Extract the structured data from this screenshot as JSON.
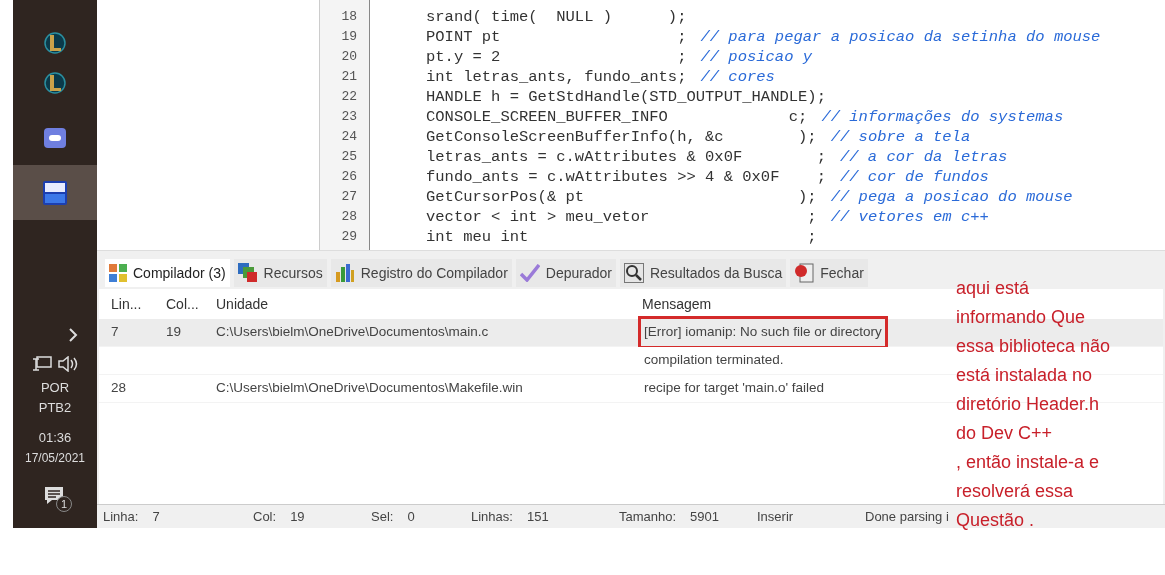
{
  "taskbar": {
    "apps": [
      {
        "kind": "game",
        "active": false
      },
      {
        "kind": "game",
        "active": false
      },
      {
        "kind": "chat",
        "active": false
      },
      {
        "kind": "ide",
        "active": true
      }
    ],
    "language": "POR",
    "layout": "PTB2",
    "time": "01:36",
    "date": "17/05/2021",
    "notifications": "1"
  },
  "editor": {
    "lines": [
      {
        "n": "18",
        "code": "srand( time(  NULL )      );"
      },
      {
        "n": "19",
        "code": "POINT pt                   ;",
        "comment": "// para pegar a posicao da setinha do mouse"
      },
      {
        "n": "20",
        "code": "pt.y = 2                   ;",
        "comment": "// posicao y"
      },
      {
        "n": "21",
        "code": "int letras_ants, fundo_ants;",
        "comment": "// cores"
      },
      {
        "n": "22",
        "code": "HANDLE h = GetStdHandle(STD_OUTPUT_HANDLE);"
      },
      {
        "n": "23",
        "code": "CONSOLE_SCREEN_BUFFER_INFO             c;",
        "comment": "// informações do systemas"
      },
      {
        "n": "24",
        "code": "GetConsoleScreenBufferInfo(h, &c        );",
        "comment": "// sobre a tela"
      },
      {
        "n": "25",
        "code": "letras_ants = c.wAttributes & 0x0F        ;",
        "comment": "// a cor da letras"
      },
      {
        "n": "26",
        "code": "fundo_ants = c.wAttributes >> 4 & 0x0F    ;",
        "comment": "// cor de fundos"
      },
      {
        "n": "27",
        "code": "GetCursorPos(& pt                       );",
        "comment": "// pega a posicao do mouse"
      },
      {
        "n": "28",
        "code": "vector < int > meu_vetor                 ;",
        "comment": "// vetores em c++"
      },
      {
        "n": "29",
        "code": "int meu int                              ;"
      }
    ]
  },
  "tabs": [
    {
      "label": "Compilador (3)",
      "kind": "grid",
      "selected": true
    },
    {
      "label": "Recursos",
      "kind": "resources",
      "selected": false
    },
    {
      "label": "Registro do Compilador",
      "kind": "chart",
      "selected": false
    },
    {
      "label": "Depurador",
      "kind": "check",
      "selected": false
    },
    {
      "label": "Resultados da Busca",
      "kind": "search",
      "selected": false
    },
    {
      "label": "Fechar",
      "kind": "close",
      "selected": false
    }
  ],
  "table": {
    "columns": [
      "Lin...",
      "Col...",
      "Unidade",
      "Mensagem"
    ],
    "rows": [
      {
        "line": "7",
        "col": "19",
        "unit": "C:\\Users\\bielm\\OneDrive\\Documentos\\main.c",
        "message": "[Error] iomanip: No such file or directory",
        "selected": true,
        "boxed": true
      },
      {
        "message": "compilation terminated.",
        "selected": false,
        "boxed": false
      },
      {
        "line": "28",
        "unit": "C:\\Users\\bielm\\OneDrive\\Documentos\\Makefile.win",
        "message": "recipe for target 'main.o' failed",
        "selected": false,
        "boxed": false
      }
    ]
  },
  "status_bar": [
    {
      "label": "Linha:",
      "value": "7"
    },
    {
      "label": "Col:",
      "value": "19"
    },
    {
      "label": "Sel:",
      "value": "0"
    },
    {
      "label": "Linhas:",
      "value": "151"
    },
    {
      "label": "Tamanho:",
      "value": "5901"
    },
    {
      "value": "Inserir"
    },
    {
      "value": "Done parsing i"
    }
  ],
  "annotation": {
    "lines": [
      "aqui está",
      "informando Que",
      "essa biblioteca não",
      "está instalada no",
      "diretório Header.h",
      "do Dev C++",
      ", então instale-a e",
      "resolverá essa",
      "Questão ."
    ]
  }
}
